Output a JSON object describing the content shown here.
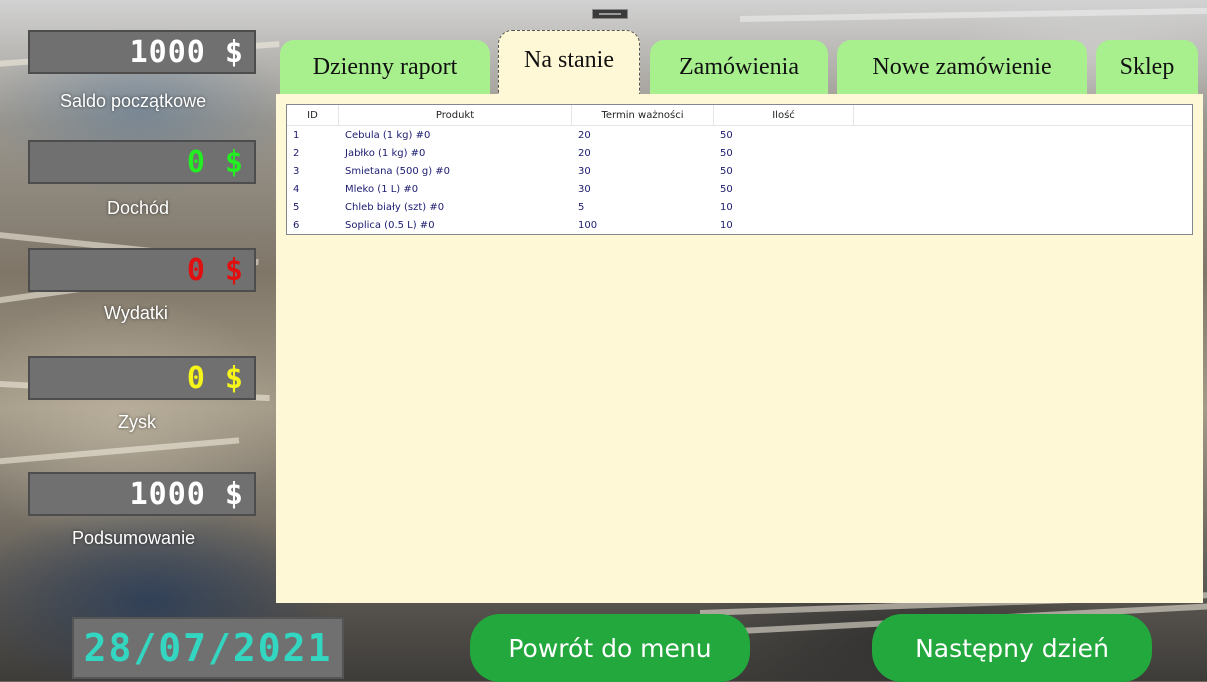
{
  "left_panel": {
    "opening_balance": {
      "value": "1000 $",
      "label": "Saldo początkowe",
      "color": "#ffffff"
    },
    "income": {
      "value": "0 $",
      "label": "Dochód",
      "color": "#22ee22"
    },
    "expenses": {
      "value": "0 $",
      "label": "Wydatki",
      "color": "#e01010"
    },
    "profit": {
      "value": "0 $",
      "label": "Zysk",
      "color": "#f5f51a"
    },
    "summary": {
      "value": "1000 $",
      "label": "Podsumowanie",
      "color": "#ffffff"
    }
  },
  "tabs": [
    {
      "label": "Dzienny raport",
      "active": false
    },
    {
      "label": "Na stanie",
      "active": true
    },
    {
      "label": "Zamówienia",
      "active": false
    },
    {
      "label": "Nowe zamówienie",
      "active": false
    },
    {
      "label": "Sklep",
      "active": false
    }
  ],
  "table": {
    "columns": [
      "ID",
      "Produkt",
      "Termin ważności",
      "Ilość"
    ],
    "rows": [
      [
        "1",
        "Cebula (1 kg) #0",
        "20",
        "50"
      ],
      [
        "2",
        "Jabłko (1 kg) #0",
        "20",
        "50"
      ],
      [
        "3",
        "Śmietana (500 g) #0",
        "30",
        "50"
      ],
      [
        "4",
        "Mleko (1 L) #0",
        "30",
        "50"
      ],
      [
        "5",
        "Chleb biały (szt) #0",
        "5",
        "10"
      ],
      [
        "6",
        "Soplica (0.5 L) #0",
        "100",
        "10"
      ]
    ]
  },
  "bottom": {
    "date": "28/07/2021",
    "back_button": "Powrót do menu",
    "next_day_button": "Następny dzień"
  },
  "colors": {
    "tab_inactive": "#a8f08e",
    "panel_bg": "#fff8d6",
    "button_green": "#22a83c",
    "date_digits": "#33d6c0"
  }
}
